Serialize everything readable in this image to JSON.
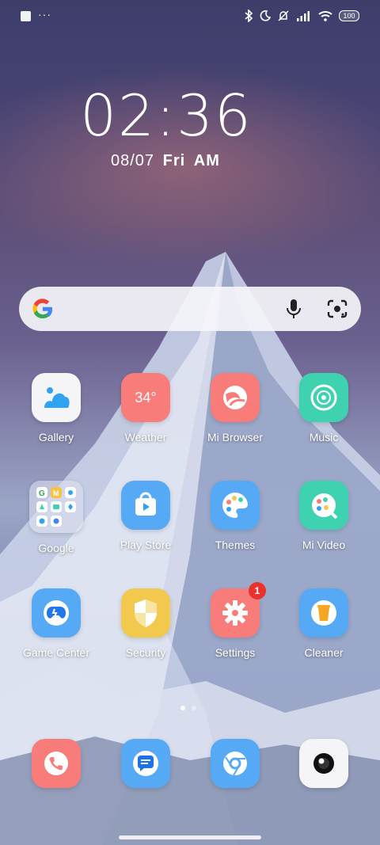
{
  "status": {
    "left_icons": [
      "app-square-icon",
      "more-dots-icon"
    ],
    "dots": "···",
    "right_icons": [
      "bluetooth-icon",
      "do-not-disturb-icon",
      "notifications-muted-icon",
      "signal-icon",
      "wifi-icon",
      "battery-icon"
    ],
    "battery": "100"
  },
  "clock": {
    "time": "02:36",
    "date": "08/07",
    "weekday": "Fri",
    "ampm": "AM"
  },
  "search": {
    "left": "google-g-icon",
    "mic": "microphone-icon",
    "lens": "google-lens-icon"
  },
  "apps": [
    {
      "label": "Gallery",
      "icon": "gallery-icon",
      "color": "#f5f5f7"
    },
    {
      "label": "Weather",
      "icon": "weather-icon",
      "text": "34°",
      "color": "#f77c7a"
    },
    {
      "label": "Mi Browser",
      "icon": "browser-icon",
      "color": "#f77c7a"
    },
    {
      "label": "Music",
      "icon": "music-icon",
      "color": "#3fd2b1"
    },
    {
      "label": "Google",
      "icon": "google-folder-icon",
      "color": "#d7dbea"
    },
    {
      "label": "Play Store",
      "icon": "play-store-icon",
      "color": "#56a9f5"
    },
    {
      "label": "Themes",
      "icon": "themes-icon",
      "color": "#56a9f5"
    },
    {
      "label": "Mi Video",
      "icon": "video-icon",
      "color": "#3fd2b1"
    },
    {
      "label": "Game Center",
      "icon": "game-center-icon",
      "color": "#56a9f5"
    },
    {
      "label": "Security",
      "icon": "security-icon",
      "color": "#f2c94c"
    },
    {
      "label": "Settings",
      "icon": "settings-icon",
      "color": "#f77c7a",
      "badge": "1"
    },
    {
      "label": "Cleaner",
      "icon": "cleaner-icon",
      "color": "#56a9f5"
    }
  ],
  "dock": [
    {
      "icon": "phone-icon",
      "color": "#f77c7a"
    },
    {
      "icon": "messages-icon",
      "color": "#56a9f5"
    },
    {
      "icon": "chrome-icon",
      "color": "#56a9f5"
    },
    {
      "icon": "camera-icon",
      "color": "#f5f5f7"
    }
  ],
  "pager": {
    "pages": 2,
    "current": 1
  }
}
